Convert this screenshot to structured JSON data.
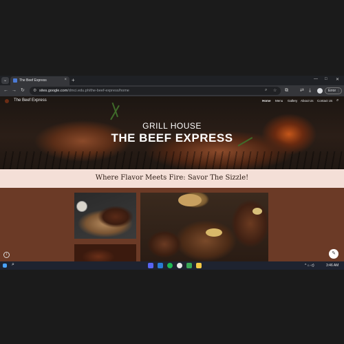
{
  "browser": {
    "tab_menu_icon": "chevron-down-icon",
    "tab_title": "The Beef Express",
    "tab_close": "×",
    "new_tab": "+",
    "window_controls": [
      "—",
      "□",
      "✕"
    ],
    "url_host": "sites.google.com",
    "url_path": "/dmci.edu.ph/the-beef-express/home",
    "error_label": "Error"
  },
  "site": {
    "name": "The Beef Express",
    "nav": [
      "Home",
      "Menu",
      "Gallery",
      "About Us",
      "Contact Us"
    ],
    "hero_subtitle": "GRILL HOUSE",
    "hero_title": "THE BEEF EXPRESS",
    "tagline": "Where Flavor Meets Fire: Savor The Sizzle!"
  },
  "taskbar": {
    "time": "3:46 AM"
  },
  "colors": {
    "site_background": "#6b3a26",
    "tagline_band": "#f4dfd7",
    "browser_dark": "#202124"
  }
}
